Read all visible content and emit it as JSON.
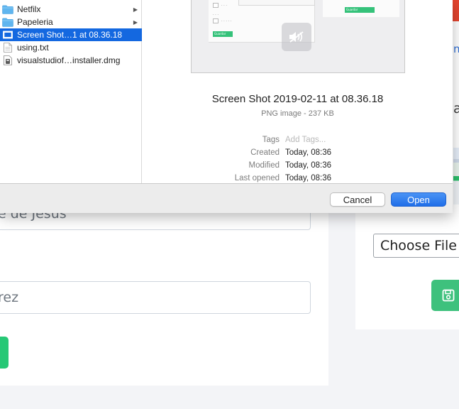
{
  "background": {
    "input_1_value": "e de Jesus",
    "input_2_value": "rez",
    "choose_file_label": "Choose File",
    "colors": {
      "accent_green": "#27c876",
      "save_green": "#3ec17d",
      "red_strip": "#e4452f"
    },
    "glyph_blue": "n",
    "glyph_dark": "a"
  },
  "dialog": {
    "files": [
      {
        "name": "Netfilx",
        "icon": "folder-icon",
        "has_children": true,
        "selected": false
      },
      {
        "name": "Papeleria",
        "icon": "folder-icon",
        "has_children": true,
        "selected": false
      },
      {
        "name": "Screen Shot…1 at 08.36.18",
        "icon": "image-file-icon",
        "has_children": false,
        "selected": true
      },
      {
        "name": "using.txt",
        "icon": "text-file-icon",
        "has_children": false,
        "selected": false
      },
      {
        "name": "visualstudiof…installer.dmg",
        "icon": "disk-image-icon",
        "has_children": false,
        "selected": false
      }
    ],
    "preview": {
      "title": "Screen Shot 2019-02-11 at 08.36.18",
      "kind": "PNG image - 237 KB",
      "thumb_green_label_a": "Guardar",
      "thumb_green_label_b": "Guardar",
      "meta": [
        {
          "key": "Tags",
          "value": "Add Tags...",
          "placeholder": true
        },
        {
          "key": "Created",
          "value": "Today, 08:36",
          "placeholder": false
        },
        {
          "key": "Modified",
          "value": "Today, 08:36",
          "placeholder": false
        },
        {
          "key": "Last opened",
          "value": "Today, 08:36",
          "placeholder": false
        }
      ]
    },
    "buttons": {
      "cancel": "Cancel",
      "open": "Open"
    },
    "colors": {
      "selection": "#1468e0",
      "primary_button": "#1f6ee8"
    }
  }
}
